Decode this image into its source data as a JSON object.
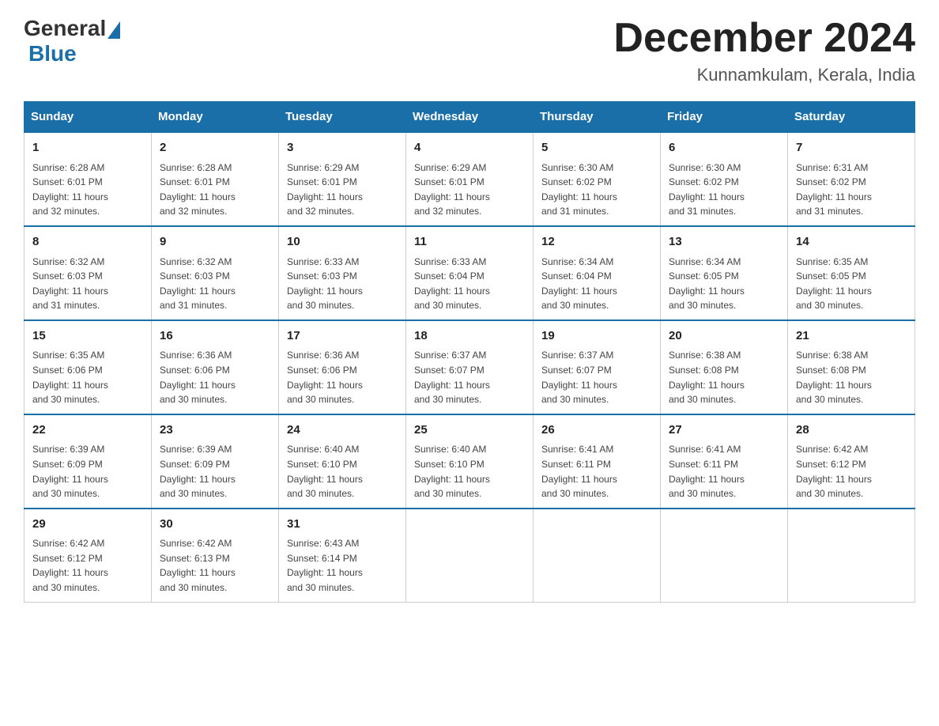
{
  "logo": {
    "general": "General",
    "blue": "Blue"
  },
  "header": {
    "month": "December 2024",
    "location": "Kunnamkulam, Kerala, India"
  },
  "weekdays": [
    "Sunday",
    "Monday",
    "Tuesday",
    "Wednesday",
    "Thursday",
    "Friday",
    "Saturday"
  ],
  "weeks": [
    [
      {
        "day": "1",
        "sunrise": "6:28 AM",
        "sunset": "6:01 PM",
        "daylight": "11 hours and 32 minutes."
      },
      {
        "day": "2",
        "sunrise": "6:28 AM",
        "sunset": "6:01 PM",
        "daylight": "11 hours and 32 minutes."
      },
      {
        "day": "3",
        "sunrise": "6:29 AM",
        "sunset": "6:01 PM",
        "daylight": "11 hours and 32 minutes."
      },
      {
        "day": "4",
        "sunrise": "6:29 AM",
        "sunset": "6:01 PM",
        "daylight": "11 hours and 32 minutes."
      },
      {
        "day": "5",
        "sunrise": "6:30 AM",
        "sunset": "6:02 PM",
        "daylight": "11 hours and 31 minutes."
      },
      {
        "day": "6",
        "sunrise": "6:30 AM",
        "sunset": "6:02 PM",
        "daylight": "11 hours and 31 minutes."
      },
      {
        "day": "7",
        "sunrise": "6:31 AM",
        "sunset": "6:02 PM",
        "daylight": "11 hours and 31 minutes."
      }
    ],
    [
      {
        "day": "8",
        "sunrise": "6:32 AM",
        "sunset": "6:03 PM",
        "daylight": "11 hours and 31 minutes."
      },
      {
        "day": "9",
        "sunrise": "6:32 AM",
        "sunset": "6:03 PM",
        "daylight": "11 hours and 31 minutes."
      },
      {
        "day": "10",
        "sunrise": "6:33 AM",
        "sunset": "6:03 PM",
        "daylight": "11 hours and 30 minutes."
      },
      {
        "day": "11",
        "sunrise": "6:33 AM",
        "sunset": "6:04 PM",
        "daylight": "11 hours and 30 minutes."
      },
      {
        "day": "12",
        "sunrise": "6:34 AM",
        "sunset": "6:04 PM",
        "daylight": "11 hours and 30 minutes."
      },
      {
        "day": "13",
        "sunrise": "6:34 AM",
        "sunset": "6:05 PM",
        "daylight": "11 hours and 30 minutes."
      },
      {
        "day": "14",
        "sunrise": "6:35 AM",
        "sunset": "6:05 PM",
        "daylight": "11 hours and 30 minutes."
      }
    ],
    [
      {
        "day": "15",
        "sunrise": "6:35 AM",
        "sunset": "6:06 PM",
        "daylight": "11 hours and 30 minutes."
      },
      {
        "day": "16",
        "sunrise": "6:36 AM",
        "sunset": "6:06 PM",
        "daylight": "11 hours and 30 minutes."
      },
      {
        "day": "17",
        "sunrise": "6:36 AM",
        "sunset": "6:06 PM",
        "daylight": "11 hours and 30 minutes."
      },
      {
        "day": "18",
        "sunrise": "6:37 AM",
        "sunset": "6:07 PM",
        "daylight": "11 hours and 30 minutes."
      },
      {
        "day": "19",
        "sunrise": "6:37 AM",
        "sunset": "6:07 PM",
        "daylight": "11 hours and 30 minutes."
      },
      {
        "day": "20",
        "sunrise": "6:38 AM",
        "sunset": "6:08 PM",
        "daylight": "11 hours and 30 minutes."
      },
      {
        "day": "21",
        "sunrise": "6:38 AM",
        "sunset": "6:08 PM",
        "daylight": "11 hours and 30 minutes."
      }
    ],
    [
      {
        "day": "22",
        "sunrise": "6:39 AM",
        "sunset": "6:09 PM",
        "daylight": "11 hours and 30 minutes."
      },
      {
        "day": "23",
        "sunrise": "6:39 AM",
        "sunset": "6:09 PM",
        "daylight": "11 hours and 30 minutes."
      },
      {
        "day": "24",
        "sunrise": "6:40 AM",
        "sunset": "6:10 PM",
        "daylight": "11 hours and 30 minutes."
      },
      {
        "day": "25",
        "sunrise": "6:40 AM",
        "sunset": "6:10 PM",
        "daylight": "11 hours and 30 minutes."
      },
      {
        "day": "26",
        "sunrise": "6:41 AM",
        "sunset": "6:11 PM",
        "daylight": "11 hours and 30 minutes."
      },
      {
        "day": "27",
        "sunrise": "6:41 AM",
        "sunset": "6:11 PM",
        "daylight": "11 hours and 30 minutes."
      },
      {
        "day": "28",
        "sunrise": "6:42 AM",
        "sunset": "6:12 PM",
        "daylight": "11 hours and 30 minutes."
      }
    ],
    [
      {
        "day": "29",
        "sunrise": "6:42 AM",
        "sunset": "6:12 PM",
        "daylight": "11 hours and 30 minutes."
      },
      {
        "day": "30",
        "sunrise": "6:42 AM",
        "sunset": "6:13 PM",
        "daylight": "11 hours and 30 minutes."
      },
      {
        "day": "31",
        "sunrise": "6:43 AM",
        "sunset": "6:14 PM",
        "daylight": "11 hours and 30 minutes."
      },
      null,
      null,
      null,
      null
    ]
  ],
  "labels": {
    "sunrise": "Sunrise:",
    "sunset": "Sunset:",
    "daylight": "Daylight:"
  }
}
